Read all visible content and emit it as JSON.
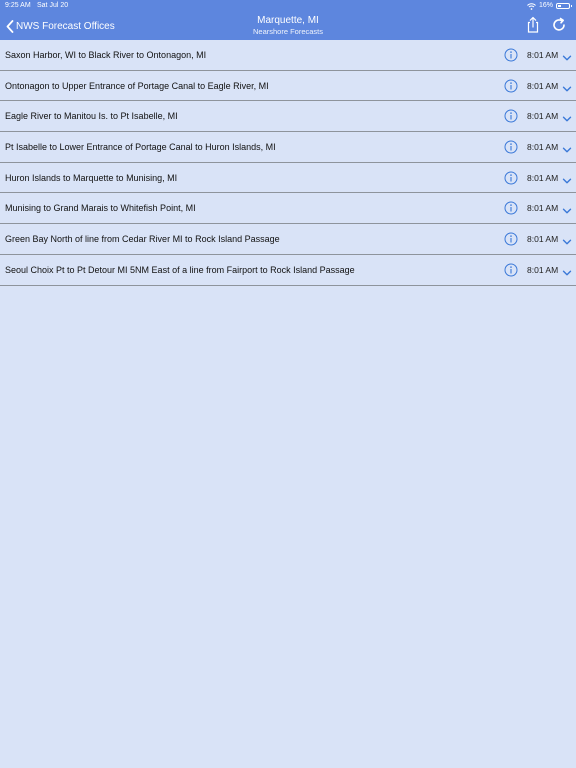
{
  "status_bar": {
    "time": "9:25 AM",
    "date": "Sat Jul 20",
    "battery": "16%"
  },
  "nav": {
    "back_label": "NWS Forecast Offices",
    "title": "Marquette, MI",
    "subtitle": "Nearshore Forecasts"
  },
  "colors": {
    "nav_bg": "#5d86de",
    "list_bg": "#d9e3f7",
    "accent": "#3a78d8"
  },
  "forecasts": [
    {
      "label": "Saxon Harbor, WI to Black River to Ontonagon, MI",
      "time": "8:01 AM"
    },
    {
      "label": "Ontonagon to Upper Entrance of Portage Canal to Eagle River, MI",
      "time": "8:01 AM"
    },
    {
      "label": "Eagle River to Manitou Is. to Pt Isabelle, MI",
      "time": "8:01 AM"
    },
    {
      "label": "Pt Isabelle to Lower Entrance of Portage Canal to Huron Islands, MI",
      "time": "8:01 AM"
    },
    {
      "label": "Huron Islands to Marquette to Munising, MI",
      "time": "8:01 AM"
    },
    {
      "label": "Munising to Grand Marais to Whitefish Point, MI",
      "time": "8:01 AM"
    },
    {
      "label": "Green Bay North of line from Cedar River MI to Rock Island Passage",
      "time": "8:01 AM"
    },
    {
      "label": "Seoul Choix Pt to Pt Detour MI 5NM East of a line from Fairport to Rock Island Passage",
      "time": "8:01 AM"
    }
  ]
}
